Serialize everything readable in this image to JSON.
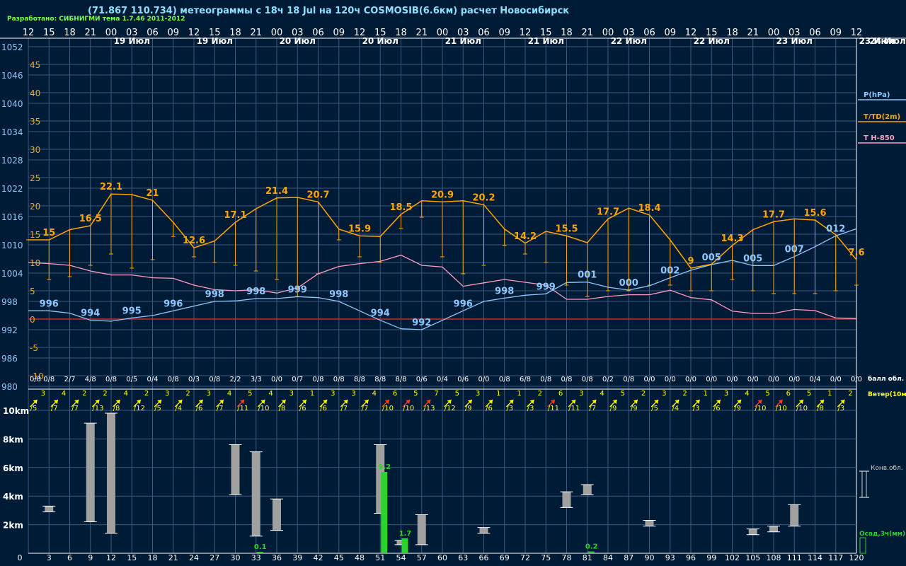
{
  "header": {
    "title": "(71.867 110.734) метеограммы с  18ч 18 Jul на 120ч COSMOSIB(6.6км) расчет Новосибирск",
    "credit": "Разработано: СИБНИГМИ тема 1.7.46 2011-2012"
  },
  "colors": {
    "background": "#001b35",
    "grid": "#3a5a80",
    "pressure": "#8ec8ff",
    "temperature": "#ffa500",
    "t850": "#ff9ec0",
    "zero_line": "#c03030",
    "wind_normal": "#ffff00",
    "wind_strong": "#ff4020",
    "cloud_bar": "#a0a0a0",
    "precip_bar": "#2ad42a"
  },
  "chart_data": [
    {
      "type": "line",
      "name": "meteogram-main",
      "top_hours": [
        "12",
        "15",
        "18",
        "21",
        "00",
        "03",
        "06",
        "09",
        "12",
        "15",
        "18",
        "21",
        "00",
        "03",
        "06",
        "09",
        "12",
        "15",
        "18",
        "21",
        "00",
        "03",
        "06",
        "09",
        "12",
        "15",
        "18",
        "21",
        "00",
        "03",
        "06",
        "09",
        "12",
        "15",
        "18",
        "21",
        "00",
        "03",
        "06",
        "09",
        "12"
      ],
      "days": [
        {
          "x": 15,
          "label": "19 Июл"
        },
        {
          "x": 27,
          "label": "19 Июл"
        },
        {
          "x": 39,
          "label": "20 Июл"
        },
        {
          "x": 51,
          "label": "20 Июл"
        },
        {
          "x": 63,
          "label": "21 Июл"
        },
        {
          "x": 75,
          "label": "21 Июл"
        },
        {
          "x": 87,
          "label": "22 Июл"
        },
        {
          "x": 99,
          "label": "22 Июл"
        },
        {
          "x": 111,
          "label": "23 Июл"
        },
        {
          "x": 123,
          "label": "23 Июл"
        }
      ],
      "next_day_label": "24 Июл",
      "pressure_ticks": [
        "1052",
        "1046",
        "1040",
        "1034",
        "1028",
        "1022",
        "1016",
        "1010",
        "1004",
        "998",
        "992",
        "986",
        "980"
      ],
      "temp_ticks": [
        "45",
        "40",
        "35",
        "30",
        "25",
        "20",
        "15",
        "10",
        "5",
        "0",
        "-5",
        "-10"
      ],
      "legend": [
        "P(hPa)",
        "T/TD(2m)",
        "T H-850"
      ],
      "x": [
        0,
        3,
        6,
        9,
        12,
        15,
        18,
        21,
        24,
        27,
        30,
        33,
        36,
        39,
        42,
        45,
        48,
        51,
        54,
        57,
        60,
        63,
        66,
        69,
        72,
        75,
        78,
        81,
        84,
        87,
        90,
        93,
        96,
        99,
        102,
        105,
        108,
        111,
        114,
        117,
        120
      ],
      "pressure": [
        996,
        996,
        995.5,
        994,
        993.8,
        994.5,
        995,
        996,
        997,
        998,
        998.1,
        998.6,
        998.6,
        999,
        998.8,
        998,
        996,
        994,
        992.2,
        992,
        994,
        996,
        998,
        998.7,
        999.3,
        999.6,
        1002,
        1002.1,
        1001,
        1000.4,
        1001.3,
        1003,
        1004.6,
        1005.8,
        1006.7,
        1005.6,
        1005.6,
        1007.5,
        1009.6,
        1011.9,
        1013.4
      ],
      "temperature": [
        14,
        14,
        15.8,
        16.5,
        22.1,
        22,
        21,
        17.1,
        12.6,
        13.8,
        17.1,
        19.5,
        21.4,
        21.5,
        20.7,
        15.9,
        14.7,
        14.6,
        18.5,
        20.9,
        20.7,
        20.9,
        20.2,
        15.9,
        13.4,
        15.5,
        14.7,
        13.5,
        17.7,
        19.6,
        18.4,
        14,
        9,
        9.7,
        13,
        15.8,
        17.2,
        17.7,
        17.5,
        14.9,
        10.5
      ],
      "dewpoint": [
        14,
        7,
        7.5,
        9.5,
        11.5,
        9,
        10.5,
        14.6,
        11,
        10,
        9.5,
        8.5,
        7,
        4,
        8,
        14,
        11,
        10,
        16,
        18,
        11,
        8,
        9.5,
        13,
        11.5,
        10,
        6,
        4,
        5,
        5,
        6,
        6,
        5,
        5,
        7,
        5,
        4.5,
        4.5,
        4.5,
        5,
        6
      ],
      "t850": [
        10,
        9.8,
        9.5,
        8.5,
        7.8,
        7.8,
        7.3,
        7.2,
        6,
        5.2,
        5,
        5.2,
        4.6,
        5.5,
        8,
        9.3,
        9.8,
        10.2,
        11.3,
        9.5,
        9.2,
        5.8,
        6.4,
        7,
        6.5,
        6,
        3.5,
        3.5,
        4,
        4.3,
        4.3,
        5.1,
        3.8,
        3.4,
        1.4,
        1,
        1,
        1.7,
        1.5,
        0.2,
        0.1
      ],
      "temp_labels": [
        {
          "x": 3,
          "v": "15"
        },
        {
          "x": 9,
          "v": "16.5"
        },
        {
          "x": 12,
          "v": "22.1"
        },
        {
          "x": 18,
          "v": "21"
        },
        {
          "x": 24,
          "v": "12.6"
        },
        {
          "x": 30,
          "v": "17.1"
        },
        {
          "x": 36,
          "v": "21.4"
        },
        {
          "x": 42,
          "v": "20.7"
        },
        {
          "x": 48,
          "v": "15.9"
        },
        {
          "x": 54,
          "v": "18.5"
        },
        {
          "x": 60,
          "v": "20.9"
        },
        {
          "x": 66,
          "v": "20.2"
        },
        {
          "x": 72,
          "v": "14.2"
        },
        {
          "x": 78,
          "v": "15.5"
        },
        {
          "x": 84,
          "v": "17.7"
        },
        {
          "x": 90,
          "v": "18.4"
        },
        {
          "x": 96,
          "v": "9"
        },
        {
          "x": 102,
          "v": "14.3"
        },
        {
          "x": 108,
          "v": "17.7"
        },
        {
          "x": 114,
          "v": "15.6"
        },
        {
          "x": 120,
          "v": "7.6"
        }
      ],
      "pressure_labels": [
        {
          "x": 3,
          "v": "996"
        },
        {
          "x": 9,
          "v": "994"
        },
        {
          "x": 15,
          "v": "995"
        },
        {
          "x": 21,
          "v": "996"
        },
        {
          "x": 27,
          "v": "998"
        },
        {
          "x": 33,
          "v": "998"
        },
        {
          "x": 39,
          "v": "999"
        },
        {
          "x": 45,
          "v": "998"
        },
        {
          "x": 51,
          "v": "994"
        },
        {
          "x": 57,
          "v": "992"
        },
        {
          "x": 63,
          "v": "996"
        },
        {
          "x": 69,
          "v": "998"
        },
        {
          "x": 75,
          "v": "999"
        },
        {
          "x": 81,
          "v": "001"
        },
        {
          "x": 87,
          "v": "000"
        },
        {
          "x": 93,
          "v": "002"
        },
        {
          "x": 99,
          "v": "005"
        },
        {
          "x": 105,
          "v": "005"
        },
        {
          "x": 111,
          "v": "007"
        },
        {
          "x": 117,
          "v": "012"
        }
      ]
    },
    {
      "type": "table",
      "name": "cloud-wind-strip",
      "clouds": [
        "0/8",
        "0/8",
        "2/7",
        "4/8",
        "0/8",
        "0/5",
        "0/4",
        "0/8",
        "0/3",
        "0/8",
        "2/2",
        "3/3",
        "0/0",
        "0/7",
        "0/8",
        "0/8",
        "8/8",
        "8/8",
        "8/8",
        "0/6",
        "0/4",
        "0/6",
        "0/0",
        "0/8",
        "6/8",
        "0/8",
        "0/8",
        "0/8",
        "0/2",
        "0/8",
        "0/0",
        "0/0",
        "0/0",
        "0/0",
        "0/0",
        "0/0",
        "0/0",
        "0/0",
        "0/4",
        "0/0",
        "0/0"
      ],
      "cloud_label": "балл обл. ниж/общ",
      "wind_label": "Ветер(10м) /порыв",
      "wind": [
        {
          "s": "3",
          "g": "/5"
        },
        {
          "s": "4",
          "g": "/7"
        },
        {
          "s": "2",
          "g": "/7"
        },
        {
          "s": "2",
          "g": "/13"
        },
        {
          "s": "4",
          "g": "/8"
        },
        {
          "s": "2",
          "g": "/12"
        },
        {
          "s": "3",
          "g": "/5"
        },
        {
          "s": "2",
          "g": "/4"
        },
        {
          "s": "3",
          "g": "/6"
        },
        {
          "s": "4",
          "g": "/7"
        },
        {
          "s": "5",
          "g": "/11",
          "strong": true
        },
        {
          "s": "4",
          "g": "/10"
        },
        {
          "s": "3",
          "g": "/8"
        },
        {
          "s": "1",
          "g": "/6"
        },
        {
          "s": "3",
          "g": "/6"
        },
        {
          "s": "3",
          "g": "/7"
        },
        {
          "s": "4",
          "g": "/7"
        },
        {
          "s": "6",
          "g": "/10",
          "strong": true
        },
        {
          "s": "5",
          "g": "/10",
          "strong": true
        },
        {
          "s": "7",
          "g": "/13",
          "strong": true
        },
        {
          "s": "5",
          "g": "/12"
        },
        {
          "s": "3",
          "g": "/9"
        },
        {
          "s": "1",
          "g": "/6"
        },
        {
          "s": "1",
          "g": "/3"
        },
        {
          "s": "2",
          "g": "/3"
        },
        {
          "s": "6",
          "g": "/11",
          "strong": true
        },
        {
          "s": "3",
          "g": "/11"
        },
        {
          "s": "4",
          "g": "/7"
        },
        {
          "s": "5",
          "g": "/9"
        },
        {
          "s": "2",
          "g": "/9"
        },
        {
          "s": "3",
          "g": "/5"
        },
        {
          "s": "2",
          "g": "/4"
        },
        {
          "s": "1",
          "g": "/3"
        },
        {
          "s": "3",
          "g": "/6"
        },
        {
          "s": "4",
          "g": "/9"
        },
        {
          "s": "5",
          "g": "/10",
          "strong": true
        },
        {
          "s": "6",
          "g": "/10",
          "strong": true
        },
        {
          "s": "5",
          "g": "/10"
        },
        {
          "s": "1",
          "g": "/8"
        },
        {
          "s": "2",
          "g": "/3"
        }
      ]
    },
    {
      "type": "bar",
      "name": "convective-clouds-and-precip",
      "y_ticks": [
        "10km",
        "8km",
        "6km",
        "4km",
        "2km"
      ],
      "x_ticks": [
        "0",
        "3",
        "6",
        "9",
        "12",
        "15",
        "18",
        "21",
        "24",
        "27",
        "30",
        "33",
        "36",
        "39",
        "42",
        "45",
        "48",
        "51",
        "54",
        "57",
        "60",
        "63",
        "66",
        "69",
        "72",
        "75",
        "78",
        "81",
        "84",
        "87",
        "90",
        "93",
        "96",
        "99",
        "102",
        "105",
        "108",
        "111",
        "114",
        "117",
        "120"
      ],
      "legend_clouds": "Конв.обл.",
      "legend_precip": "Осад,3ч(мм)",
      "cloud_bars": [
        {
          "x": 3,
          "base_km": 2.9,
          "top_km": 3.3
        },
        {
          "x": 9,
          "base_km": 2.2,
          "top_km": 9.1
        },
        {
          "x": 12,
          "base_km": 1.4,
          "top_km": 9.8
        },
        {
          "x": 30,
          "base_km": 4.1,
          "top_km": 7.6
        },
        {
          "x": 33,
          "base_km": 1.2,
          "top_km": 7.1
        },
        {
          "x": 36,
          "base_km": 1.6,
          "top_km": 3.8
        },
        {
          "x": 51,
          "base_km": 2.8,
          "top_km": 7.6
        },
        {
          "x": 54,
          "base_km": 0.6,
          "top_km": 0.9
        },
        {
          "x": 57,
          "base_km": 0.6,
          "top_km": 2.7
        },
        {
          "x": 66,
          "base_km": 1.4,
          "top_km": 1.8
        },
        {
          "x": 78,
          "base_km": 3.2,
          "top_km": 4.3
        },
        {
          "x": 81,
          "base_km": 4.1,
          "top_km": 4.8
        },
        {
          "x": 90,
          "base_km": 1.9,
          "top_km": 2.3
        },
        {
          "x": 105,
          "base_km": 1.3,
          "top_km": 1.7
        },
        {
          "x": 108,
          "base_km": 1.5,
          "top_km": 1.9
        },
        {
          "x": 111,
          "base_km": 1.9,
          "top_km": 3.4
        }
      ],
      "precip": [
        {
          "x": 33,
          "mm": "0.1"
        },
        {
          "x": 51,
          "mm": "9.2"
        },
        {
          "x": 54,
          "mm": "1.7"
        },
        {
          "x": 81,
          "mm": "0.2"
        }
      ]
    }
  ]
}
